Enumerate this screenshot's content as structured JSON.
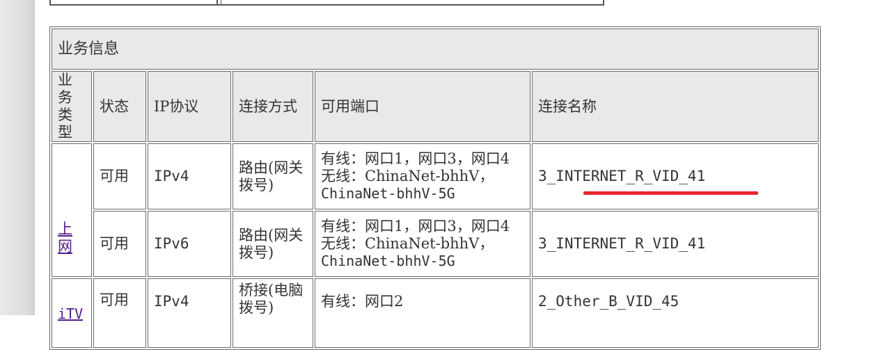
{
  "section": {
    "title": "业务信息"
  },
  "headers": [
    "业务\n类型",
    "状态",
    "IP协议",
    "连接方式",
    "可用端口",
    "连接名称"
  ],
  "rows": [
    {
      "type": "上网",
      "status": "可用",
      "protocol": "IPv4",
      "mode_l1": "路由(网关",
      "mode_l2": "拨号)",
      "port_l1": "有线：网口1，网口3，网口4",
      "port_l2": "无线：ChinaNet-bhhV，",
      "port_l3": "ChinaNet-bhhV-5G",
      "name": "3_INTERNET_R_VID_41"
    },
    {
      "status": "可用",
      "protocol": "IPv6",
      "mode_l1": "路由(网关",
      "mode_l2": "拨号)",
      "port_l1": "有线：网口1，网口3，网口4",
      "port_l2": "无线：ChinaNet-bhhV，",
      "port_l3": "ChinaNet-bhhV-5G",
      "name": "3_INTERNET_R_VID_41"
    },
    {
      "type": "iTV",
      "status": "可用",
      "protocol": "IPv4",
      "mode_l1": "桥接(电脑",
      "mode_l2": "拨号)",
      "port_l1": "有线：网口2",
      "name": "2_Other_B_VID_45"
    }
  ],
  "annotation_color": "#e8262e"
}
